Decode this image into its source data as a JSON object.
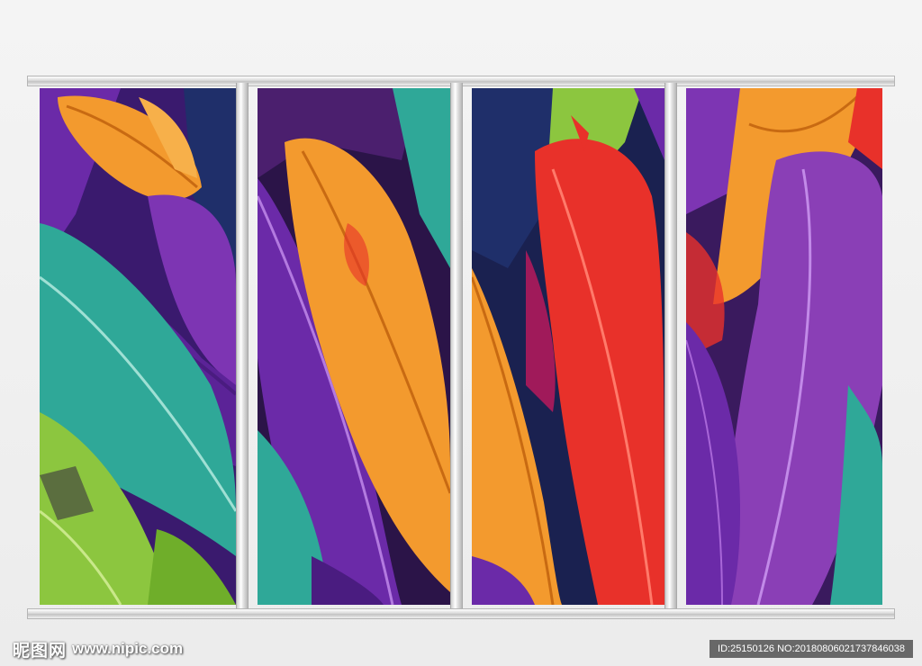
{
  "watermark": {
    "logo_text": "昵图网",
    "site_url": "www.nipic.com",
    "image_id": "ID:25150126 NO:20180806021737846038"
  },
  "artwork": {
    "subject": "colorful feathers",
    "panel_count": 4,
    "colors": {
      "orange": "#f39a2e",
      "purple": "#6b2aa8",
      "violet": "#8a3fb6",
      "teal": "#2fa898",
      "green": "#8cc63f",
      "red": "#e8312a",
      "navy": "#1f2f6a",
      "frame": "#e0e0e0"
    }
  }
}
